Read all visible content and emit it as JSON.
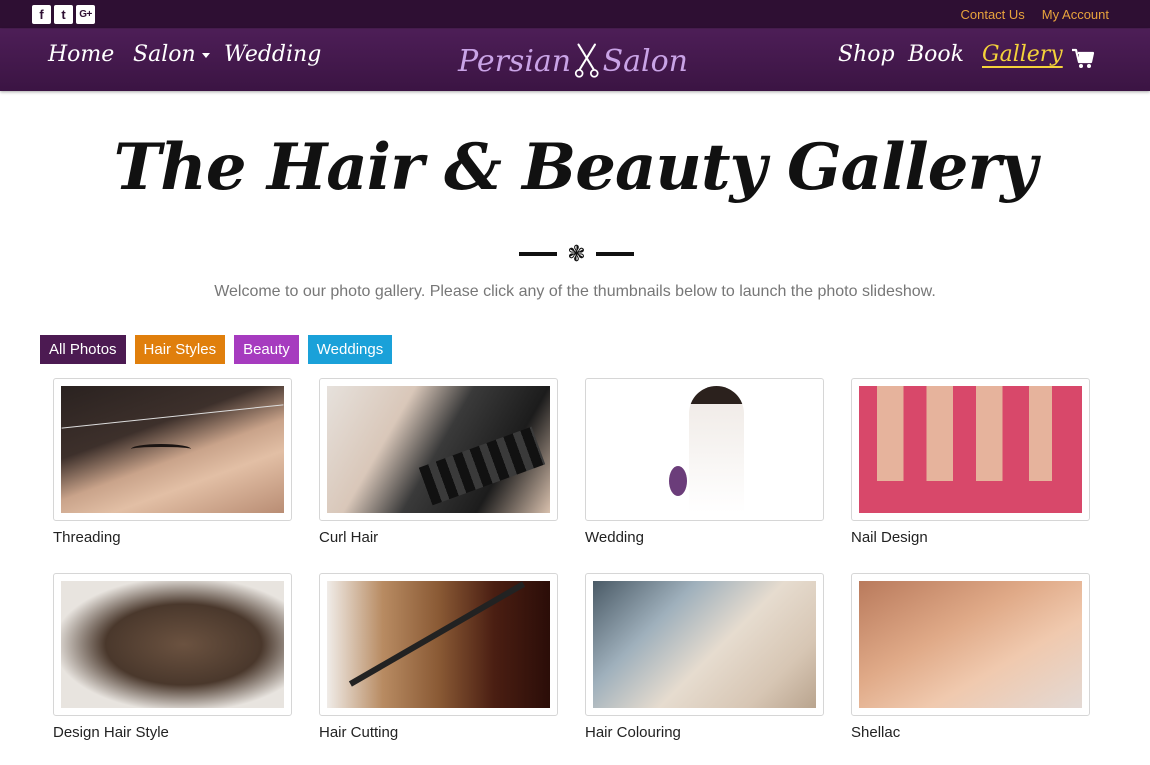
{
  "topbar": {
    "social": [
      {
        "icon": "facebook-icon",
        "glyph": "f"
      },
      {
        "icon": "twitter-icon",
        "glyph": "t"
      },
      {
        "icon": "google-plus-icon",
        "glyph": "G+"
      }
    ],
    "contact_label": "Contact Us",
    "account_label": "My Account"
  },
  "nav": {
    "home": "Home",
    "salon": "Salon",
    "wedding": "Wedding",
    "logo_left": "Persian",
    "logo_right": "Salon",
    "shop": "Shop",
    "book": "Book",
    "gallery": "Gallery",
    "cart_icon": "shopping-cart-icon"
  },
  "hero": {
    "title": "The Hair & Beauty Gallery",
    "divider_glyph": "❃",
    "intro": "Welcome to our photo gallery. Please click any of the thumbnails below to launch the photo slideshow."
  },
  "filters": [
    {
      "label": "All Photos"
    },
    {
      "label": "Hair Styles"
    },
    {
      "label": "Beauty"
    },
    {
      "label": "Weddings"
    }
  ],
  "gallery": [
    {
      "caption": "Threading"
    },
    {
      "caption": "Curl Hair"
    },
    {
      "caption": "Wedding"
    },
    {
      "caption": "Nail Design"
    },
    {
      "caption": "Design Hair Style"
    },
    {
      "caption": "Hair Cutting"
    },
    {
      "caption": "Hair Colouring"
    },
    {
      "caption": "Shellac"
    }
  ],
  "colors": {
    "topbar": "#2e0f33",
    "navbar": "#4d1e57",
    "accent_link": "#e8a33c",
    "active_nav": "#f4d23a",
    "logo": "#c9a3e6",
    "filter_all": "#4c1a52",
    "filter_hair": "#e07f0c",
    "filter_beauty": "#a63bbf",
    "filter_weddings": "#1aa1d9"
  }
}
